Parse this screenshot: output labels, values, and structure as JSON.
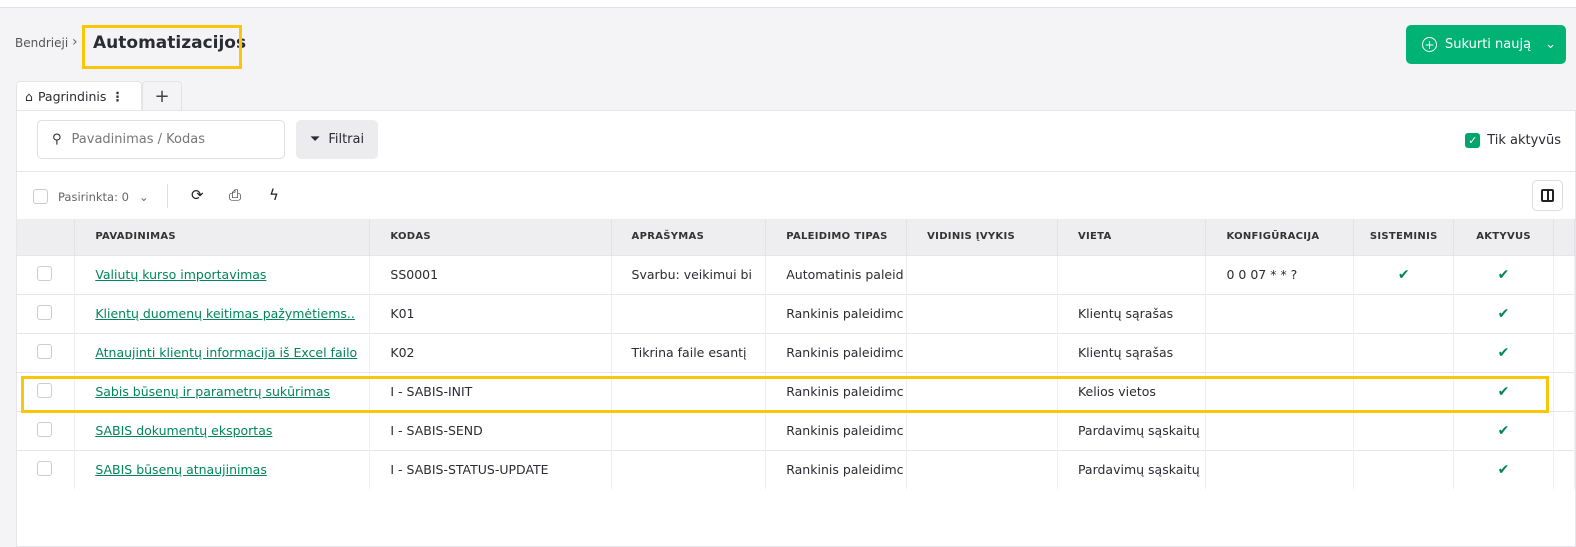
{
  "breadcrumb": {
    "parent": "Bendrieji",
    "current": "Automatizacijos"
  },
  "create_button": {
    "label": "Sukurti naują"
  },
  "tabs": [
    {
      "label": "Pagrindinis"
    },
    {
      "label": "+"
    }
  ],
  "search": {
    "placeholder": "Pavadinimas / Kodas",
    "value": ""
  },
  "filter_button": {
    "label": "Filtrai"
  },
  "only_active": {
    "label": "Tik aktyvūs",
    "checked": true
  },
  "selection": {
    "label": "Pasirinkta: 0"
  },
  "colors": {
    "accent": "#00b274",
    "link": "#00855a",
    "highlight": "#fbc60a"
  },
  "table": {
    "columns": [
      "PAVADINIMAS",
      "KODAS",
      "APRAŠYMAS",
      "PALEIDIMO TIPAS",
      "VIDINIS ĮVYKIS",
      "VIETA",
      "KONFIGŪRACIJA",
      "SISTEMINIS",
      "AKTYVUS"
    ],
    "rows": [
      {
        "name": "Valiutų kurso importavimas",
        "code": "SS0001",
        "desc": "Svarbu: veikimui bi",
        "type": "Automatinis paleid",
        "event": "",
        "place": "",
        "config": "0 0 07 * * ?",
        "system": true,
        "active": true
      },
      {
        "name": "Klientų duomenų keitimas pažymėtiems..",
        "code": "K01",
        "desc": "",
        "type": "Rankinis paleidimc",
        "event": "",
        "place": "Klientų sąrašas",
        "config": "",
        "system": false,
        "active": true
      },
      {
        "name": "Atnaujinti klientų informacija iš Excel failo",
        "code": "K02",
        "desc": "Tikrina faile esantį",
        "type": "Rankinis paleidimc",
        "event": "",
        "place": "Klientų sąrašas",
        "config": "",
        "system": false,
        "active": true
      },
      {
        "name": "Sabis būsenų ir parametrų sukūrimas",
        "code": "I - SABIS-INIT",
        "desc": "",
        "type": "Rankinis paleidimc",
        "event": "",
        "place": "Kelios vietos",
        "config": "",
        "system": false,
        "active": true
      },
      {
        "name": "SABIS dokumentų eksportas",
        "code": "I - SABIS-SEND",
        "desc": "",
        "type": "Rankinis paleidimc",
        "event": "",
        "place": "Pardavimų sąskaitų",
        "config": "",
        "system": false,
        "active": true
      },
      {
        "name": "SABIS būsenų atnaujinimas",
        "code": "I - SABIS-STATUS-UPDATE",
        "desc": "",
        "type": "Rankinis paleidimc",
        "event": "",
        "place": "Pardavimų sąskaitų",
        "config": "",
        "system": false,
        "active": true
      }
    ]
  }
}
